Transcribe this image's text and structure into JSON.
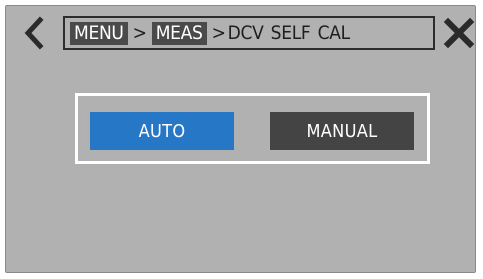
{
  "header": {
    "back_icon": "chevron-left-icon",
    "close_icon": "close-x-icon",
    "breadcrumb": {
      "items": [
        "MENU",
        "MEAS"
      ],
      "separator": ">",
      "current": "DCV SELF CAL"
    }
  },
  "options": {
    "auto_label": "AUTO",
    "manual_label": "MANUAL",
    "selected": "AUTO"
  },
  "colors": {
    "screen_bg": "#b1b1b1",
    "selected": "#2677c6",
    "unselected": "#444444",
    "highlight_frame": "#ffffff"
  }
}
